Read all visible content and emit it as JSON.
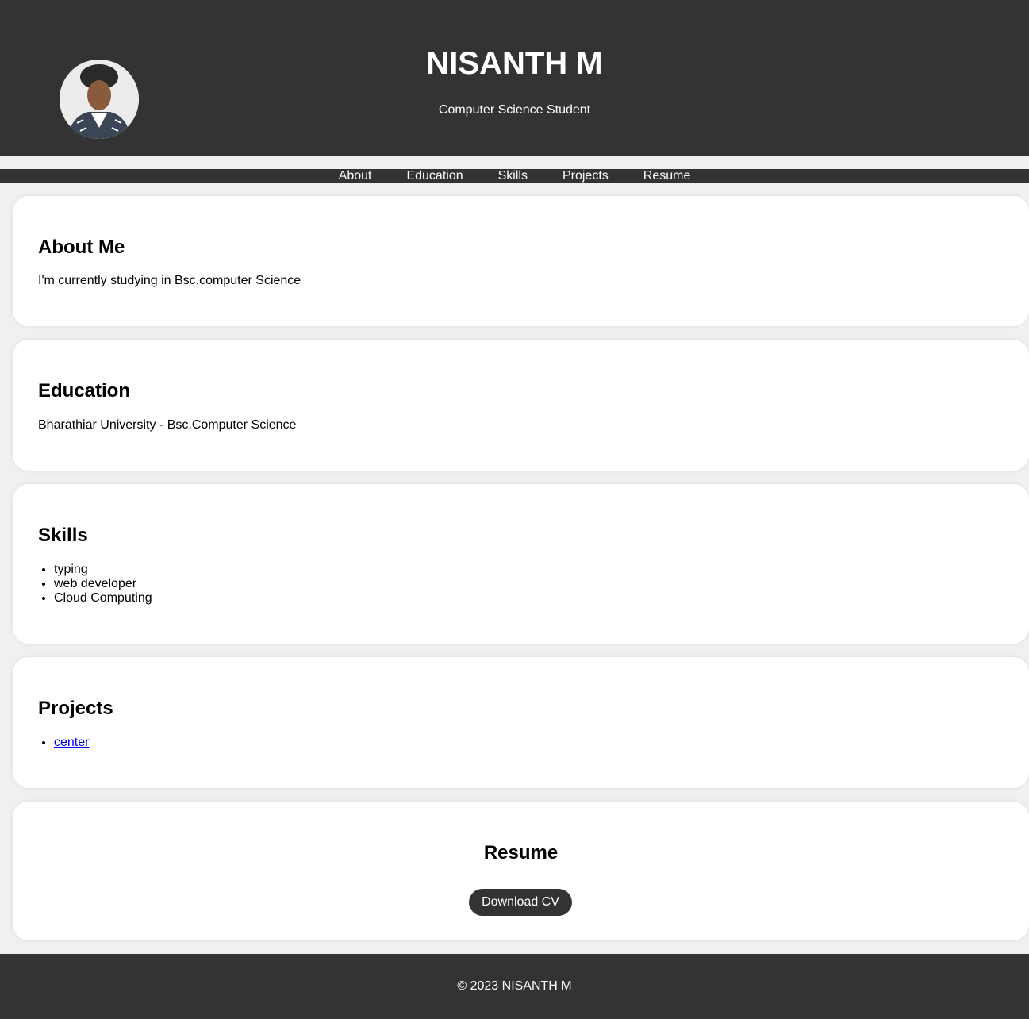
{
  "header": {
    "name": "NISANTH M",
    "tagline": "Computer Science Student",
    "avatar_icon": "profile-photo"
  },
  "nav": {
    "items": [
      {
        "label": "About"
      },
      {
        "label": "Education"
      },
      {
        "label": "Skills"
      },
      {
        "label": "Projects"
      },
      {
        "label": "Resume"
      }
    ]
  },
  "about": {
    "title": "About Me",
    "text": "I'm currently studying in Bsc.computer Science"
  },
  "education": {
    "title": "Education",
    "text": "Bharathiar University - Bsc.Computer Science"
  },
  "skills": {
    "title": "Skills",
    "items": [
      "typing",
      "web developer",
      "Cloud Computing"
    ]
  },
  "projects": {
    "title": "Projects",
    "items": [
      "center"
    ]
  },
  "resume": {
    "title": "Resume",
    "button_label": "Download CV"
  },
  "footer": {
    "text": "© 2023 NISANTH M"
  },
  "colors": {
    "dark": "#333333",
    "page_bg": "#f0f0f0",
    "card_bg": "#ffffff",
    "link": "#0000ee"
  }
}
